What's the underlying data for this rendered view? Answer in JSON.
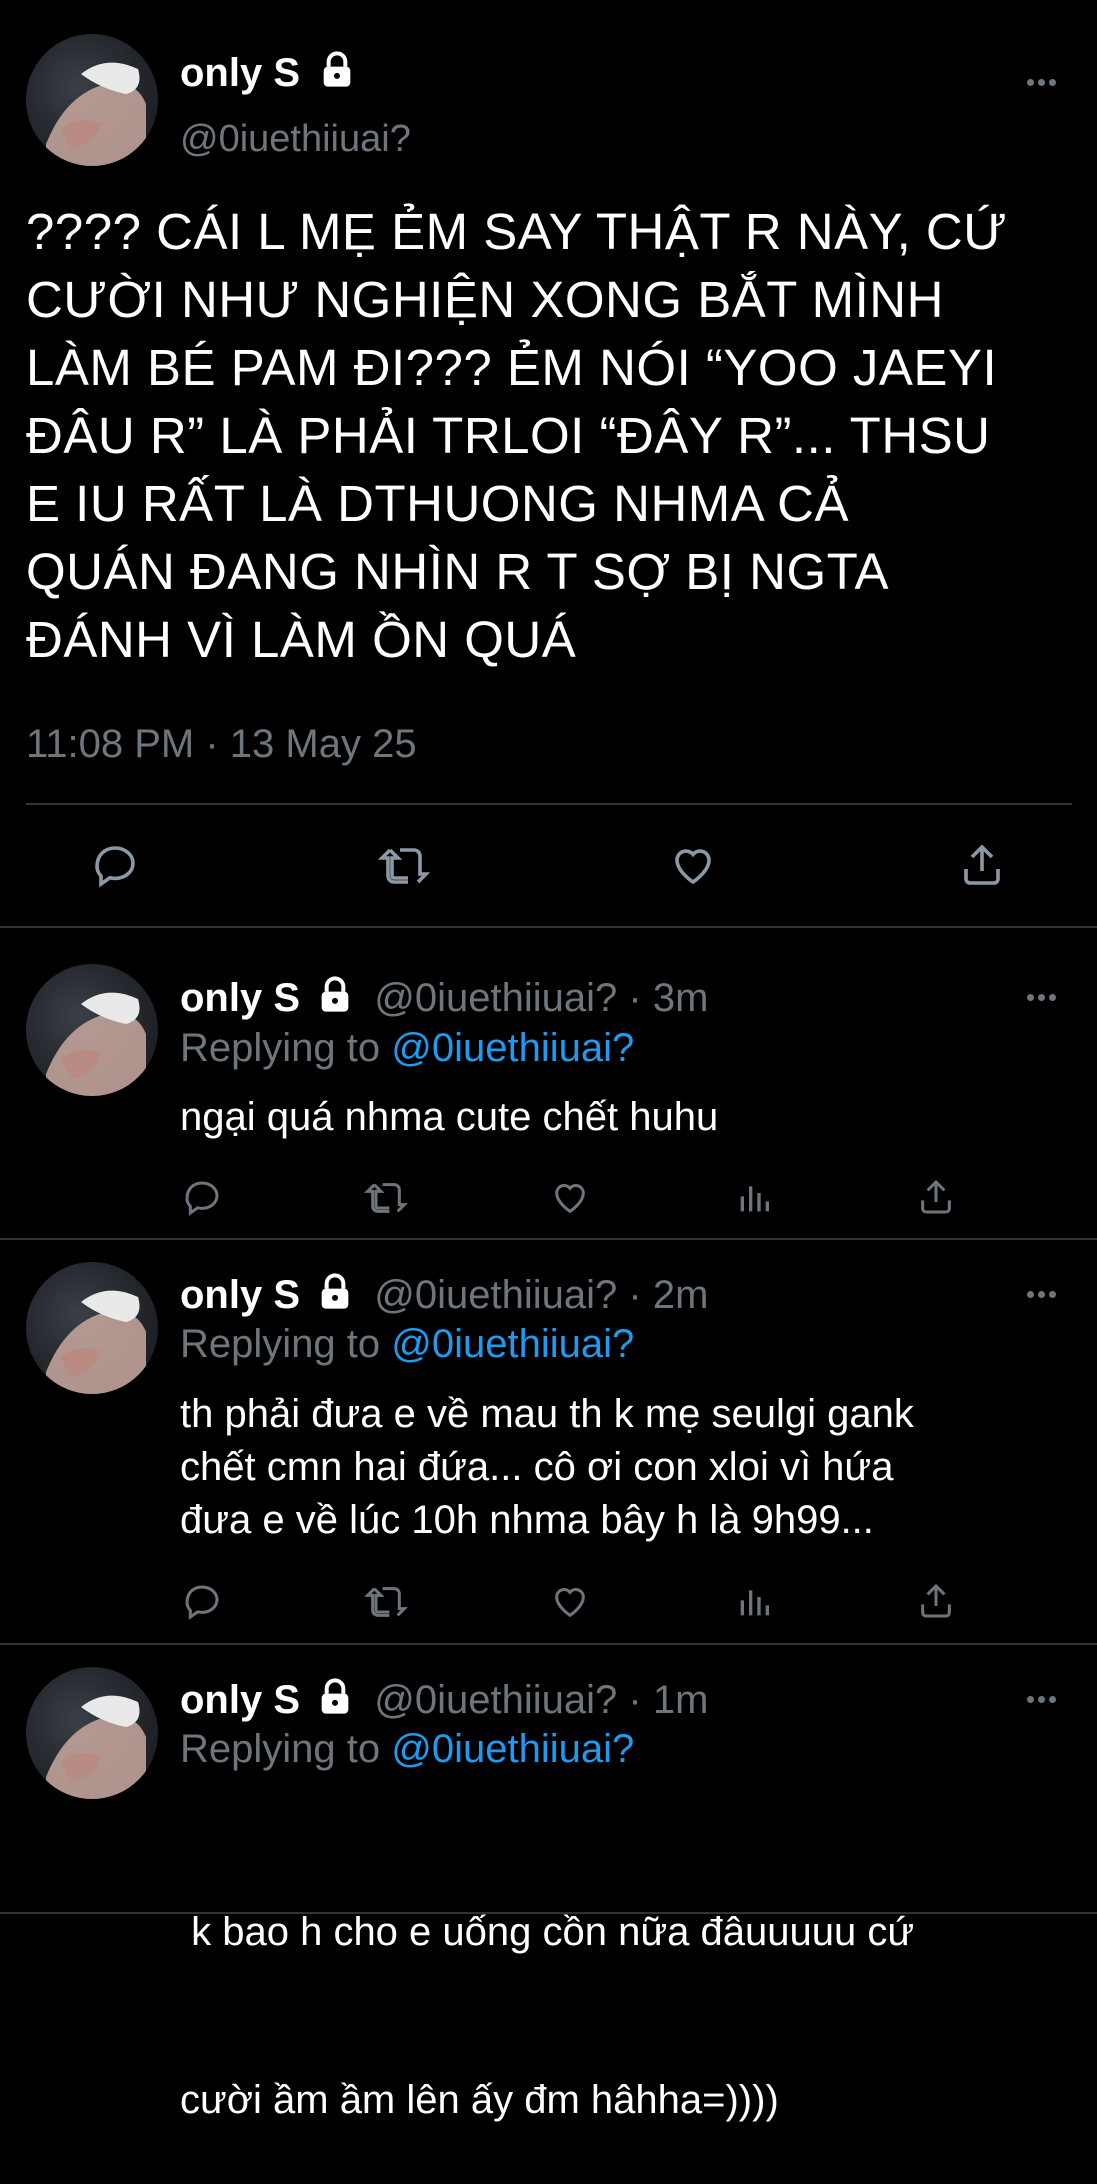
{
  "main_tweet": {
    "display_name": "only S",
    "handle": "@0iuethiiuai?",
    "text_lines": [
      "???? CÁI L MẸ ẺM SAY THẬT R NÀY, CỨ",
      "CƯỜI NHƯ NGHIỆN XONG BẮT MÌNH",
      "LÀM BÉ PAM ĐI??? ẺM NÓI “YOO JAEYI",
      "ĐÂU R” LÀ PHẢI TRLOI “ĐÂY R”... THSU",
      "E IU RẤT LÀ DTHUONG NHMA CẢ",
      "QUÁN ĐANG NHÌN R T SỢ BỊ NGTA",
      "ĐÁNH VÌ LÀM ỒN QUÁ"
    ],
    "timestamp": "11:08 PM · 13 May 25"
  },
  "replies": [
    {
      "display_name": "only S",
      "handle": "@0iuethiiuai?",
      "time": "· 3m",
      "replying_prefix": "Replying to",
      "replying_to": "@0iuethiiuai?",
      "text_lines": [
        "ngại quá nhma cute chết huhu"
      ]
    },
    {
      "display_name": "only S",
      "handle": "@0iuethiiuai?",
      "time": "· 2m",
      "replying_prefix": "Replying to",
      "replying_to": "@0iuethiiuai?",
      "text_lines": [
        "th phải đưa e về mau th k mẹ seulgi gank",
        "chết cmn hai đứa... cô ơi con xloi vì hứa",
        "đưa e về lúc 10h nhma bây h là 9h99..."
      ]
    },
    {
      "display_name": "only S",
      "handle": "@0iuethiiuai?",
      "time": "· 1m",
      "replying_prefix": "Replying to",
      "replying_to": "@0iuethiiuai?",
      "text_lines": [
        " k bao h cho e uống cồn nữa đâuuuuu cứ",
        "cười ầm ầm lên ấy đm hâhha=))))"
      ]
    }
  ],
  "icons": {
    "reply": "reply-icon",
    "retweet": "retweet-icon",
    "like": "heart-icon",
    "analytics": "analytics-icon",
    "share": "share-icon",
    "lock": "lock-icon",
    "more": "more-icon"
  },
  "colors": {
    "background": "#000000",
    "text": "#ffffff",
    "muted": "#6e767d",
    "link": "#1d9bf0",
    "divider": "#2f3336"
  }
}
